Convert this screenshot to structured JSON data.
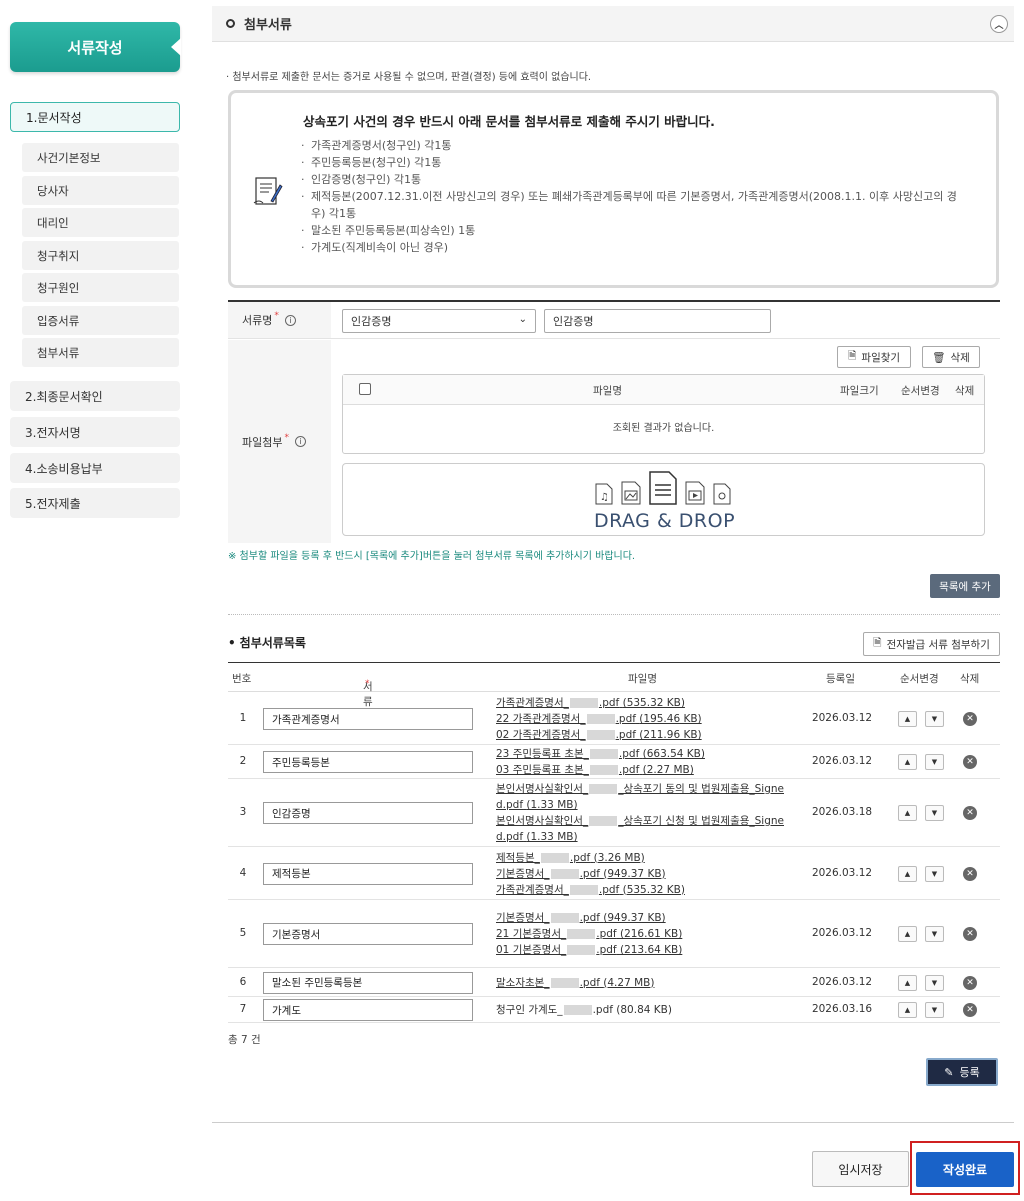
{
  "sidebar": {
    "title": "서류작성",
    "items": [
      {
        "label": "1.문서작성"
      },
      {
        "label": "사건기본정보"
      },
      {
        "label": "당사자"
      },
      {
        "label": "대리인"
      },
      {
        "label": "청구취지"
      },
      {
        "label": "청구원인"
      },
      {
        "label": "입증서류"
      },
      {
        "label": "첨부서류"
      },
      {
        "label": "2.최종문서확인"
      },
      {
        "label": "3.전자서명"
      },
      {
        "label": "4.소송비용납부"
      },
      {
        "label": "5.전자제출"
      }
    ]
  },
  "section": {
    "title": "첨부서류",
    "collapse_icon": "chevron-up-icon",
    "notice": "첨부서류로 제출한 문서는 증거로 사용될 수 없으며, 판결(결정) 등에 효력이 없습니다."
  },
  "infobox": {
    "heading": "상속포기 사건의 경우 반드시 아래 문서를 첨부서류로 제출해 주시기 바랍니다.",
    "items": [
      "가족관계증명서(청구인) 각1통",
      "주민등록등본(청구인) 각1통",
      "인감증명(청구인) 각1통",
      "제적등본(2007.12.31.이전 사망신고의 경우) 또는 폐쇄가족관계등록부에 따른 기본증명서, 가족관계증명서(2008.1.1. 이후 사망신고의 경우) 각1통",
      "말소된 주민등록등본(피상속인) 1통",
      "가계도(직계비속이 아닌 경우)"
    ]
  },
  "form": {
    "doc_label": "서류명",
    "req_mark": "*",
    "doc_select": "인감증명",
    "doc_input": "인감증명",
    "file_label": "파일첨부",
    "find_button": "파일찾기",
    "delete_button": "삭제",
    "file_table": {
      "headers": [
        "파일명",
        "파일크기",
        "순서변경",
        "삭제"
      ],
      "empty": "조회된 결과가 없습니다."
    },
    "dropzone": "DRAG & DROP",
    "note": "※ 첨부할 파일을 등록 후 반드시 [목록에 추가]버튼을 눌러 첨부서류 목록에 추가하시기 바랍니다.",
    "add_button": "목록에 추가"
  },
  "list": {
    "title": "첨부서류목록",
    "e_button": "전자발급 서류 첨부하기",
    "headers": {
      "no": "번호",
      "type": "서류명",
      "files": "파일명",
      "date": "등록일",
      "order": "순서변경",
      "del": "삭제"
    },
    "rows": [
      {
        "no": "1",
        "type": "가족관계증명서",
        "date": "2026.03.12",
        "files": [
          [
            "가족관계증명서_",
            ".pdf",
            "(535.32 KB)"
          ],
          [
            "22 가족관계증명서_",
            ".pdf",
            "(195.46 KB)"
          ],
          [
            "02 가족관계증명서_",
            ".pdf",
            "(211.96 KB)"
          ]
        ]
      },
      {
        "no": "2",
        "type": "주민등록등본",
        "date": "2026.03.12",
        "files": [
          [
            "23 주민등록표 초본_",
            ".pdf",
            "(663.54 KB)"
          ],
          [
            "03 주민등록표 초본_",
            ".pdf",
            "(2.27 MB)"
          ]
        ]
      },
      {
        "no": "3",
        "type": "인감증명",
        "date": "2026.03.18",
        "files": [
          [
            "본인서명사실확인서_",
            "_상속포기 동의 및 법원제출용_Signe",
            ""
          ],
          [
            "d.pdf",
            "",
            "(1.33 MB)"
          ],
          [
            "본인서명사실확인서_",
            "_상속포기 신청 및 법원제출용_Signe",
            ""
          ],
          [
            "d.pdf",
            "",
            "(1.33 MB)"
          ]
        ]
      },
      {
        "no": "4",
        "type": "제적등본",
        "date": "2026.03.12",
        "files": [
          [
            "제적등본_",
            ".pdf",
            "(3.26 MB)"
          ],
          [
            "기본증명서_",
            ".pdf",
            "(949.37 KB)"
          ],
          [
            "가족관계증명서_",
            ".pdf",
            "(535.32 KB)"
          ]
        ]
      },
      {
        "no": "5",
        "type": "기본증명서",
        "date": "2026.03.12",
        "files": [
          [
            "기본증명서_",
            ".pdf",
            "(949.37 KB)"
          ],
          [
            "21 기본증명서_",
            ".pdf",
            "(216.61 KB)"
          ],
          [
            "01 기본증명서_",
            ".pdf",
            "(213.64 KB)"
          ]
        ]
      },
      {
        "no": "6",
        "type": "말소된 주민등록등본",
        "date": "2026.03.12",
        "files": [
          [
            "말소자초본_",
            ".pdf",
            "(4.27 MB)"
          ]
        ]
      },
      {
        "no": "7",
        "type": "가계도",
        "date": "2026.03.16",
        "files": [
          [
            "청구인 가계도_",
            ".pdf",
            "(80.84 KB)"
          ]
        ]
      }
    ],
    "total": "총 7 건",
    "register_button": "등록"
  },
  "footer": {
    "save_button": "임시저장",
    "done_button": "작성완료"
  }
}
